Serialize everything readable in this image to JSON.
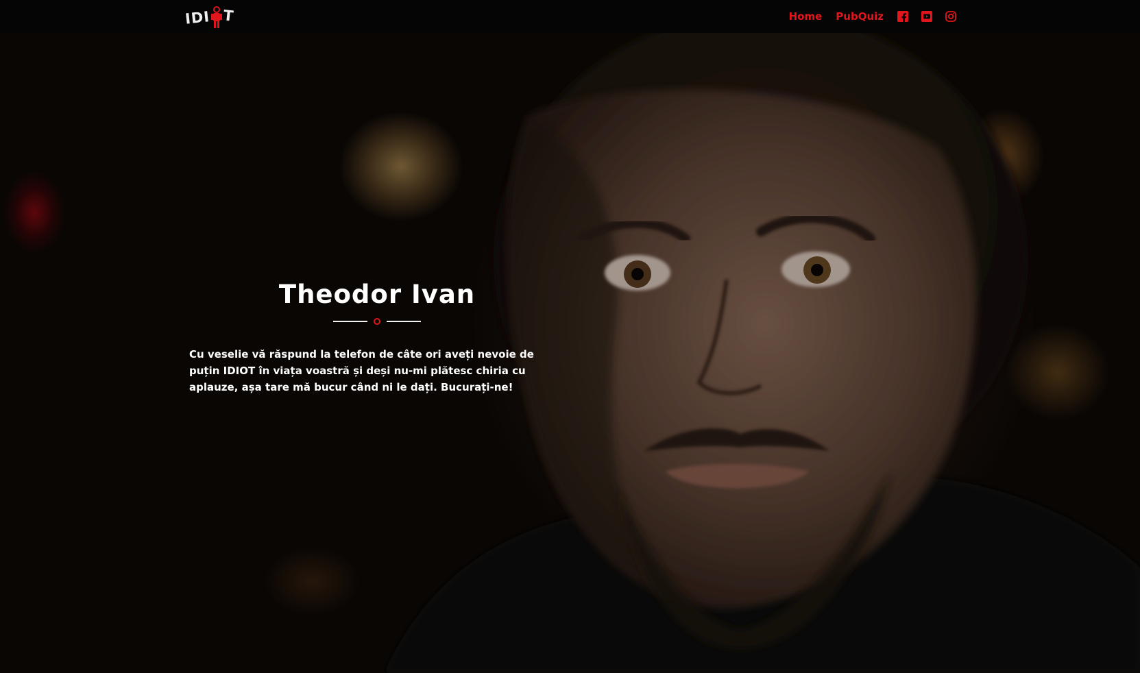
{
  "header": {
    "logo_text_left": "IDI",
    "logo_text_right": "T",
    "nav": {
      "home_label": "Home",
      "pubquiz_label": "PubQuiz"
    },
    "social_icons": [
      "facebook-icon",
      "youtube-icon",
      "instagram-icon"
    ]
  },
  "hero": {
    "title": "Theodor Ivan",
    "description": "Cu veselie vă răspund la telefon de câte ori aveți nevoie de puțin IDIOT în viața voastră și deși nu-mi plătesc chiria cu aplauze, așa tare mă bucur când ni le dați. Bucurați-ne!"
  },
  "colors": {
    "accent": "#e0161c",
    "navbar_bg": "#050505",
    "text": "#ffffff"
  }
}
